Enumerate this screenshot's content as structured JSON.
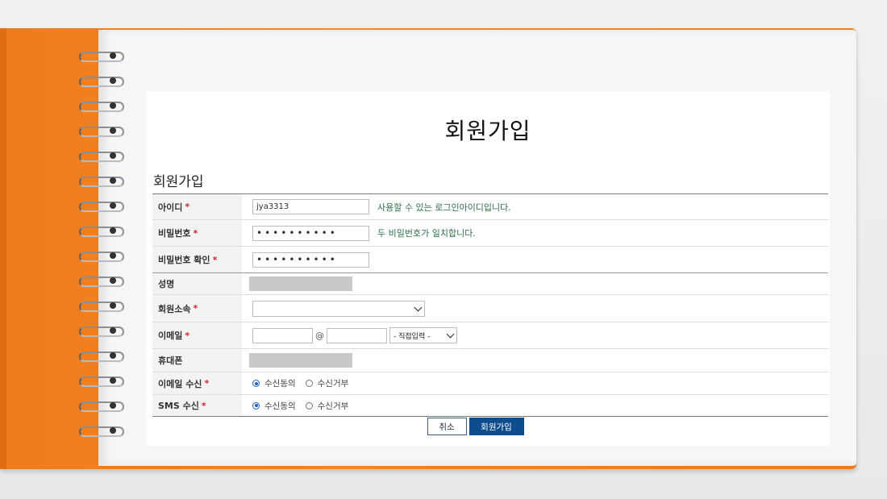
{
  "page_title": "회원가입",
  "section_title": "회원가입",
  "fields": {
    "id": {
      "label": "아이디",
      "required": "*",
      "value": "jya3313",
      "message": "사용할 수 있는 로그인아이디입니다."
    },
    "password": {
      "label": "비밀번호",
      "required": "*",
      "value": "••••••••••",
      "message": "두 비밀번호가 일치합니다."
    },
    "password_confirm": {
      "label": "비밀번호 확인",
      "required": "*",
      "value": "••••••••••"
    },
    "name": {
      "label": "성명"
    },
    "affiliation": {
      "label": "회원소속",
      "required": "*",
      "value": ""
    },
    "email": {
      "label": "이메일",
      "required": "*",
      "local": "",
      "at": "@",
      "domain": "",
      "select_value": "- 직접입력 -"
    },
    "phone": {
      "label": "휴대폰"
    },
    "email_subscribe": {
      "label": "이메일 수신",
      "required": "*",
      "option_agree": "수신동의",
      "option_reject": "수신거부",
      "selected": "수신동의"
    },
    "sms_subscribe": {
      "label": "SMS 수신",
      "required": "*",
      "option_agree": "수신동의",
      "option_reject": "수신거부",
      "selected": "수신동의"
    }
  },
  "buttons": {
    "cancel": "취소",
    "submit": "회원가입"
  },
  "colors": {
    "cover": "#f58a24",
    "primary_button": "#0d4d8e",
    "required_mark": "#d2262b",
    "success_message": "#2f6f4a",
    "radio_selected": "#1e62c9"
  }
}
